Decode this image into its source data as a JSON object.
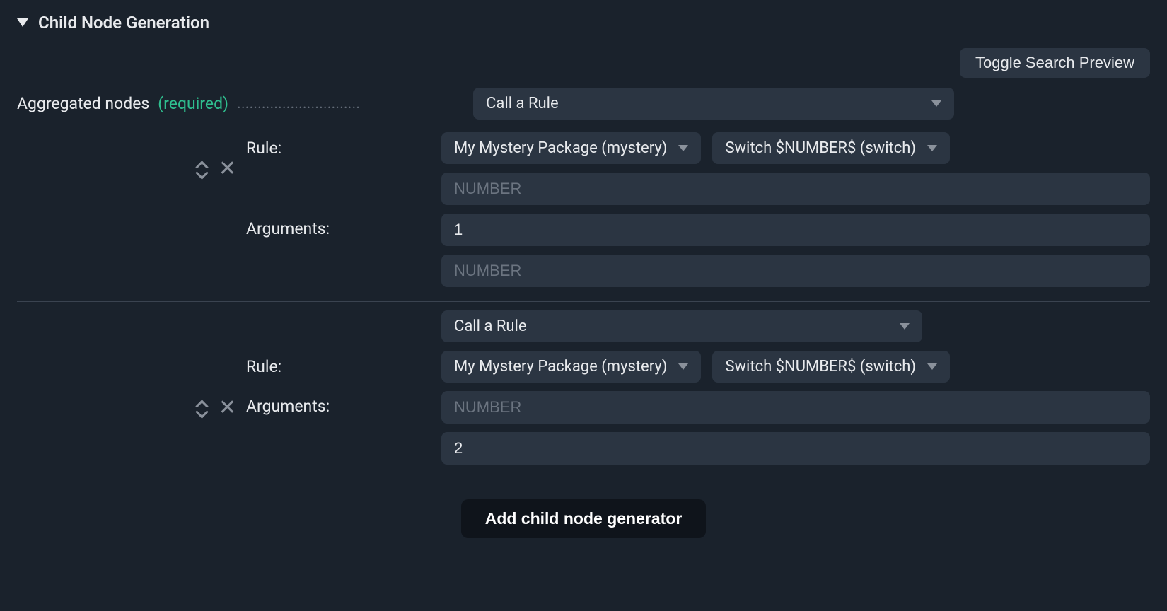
{
  "section": {
    "title": "Child Node Generation"
  },
  "toggle": {
    "label": "Toggle Search Preview"
  },
  "aggregated": {
    "label": "Aggregated nodes",
    "required": "(required)",
    "dots": "..............................",
    "action": "Call a Rule"
  },
  "labels": {
    "rule": "Rule:",
    "arguments": "Arguments:"
  },
  "placeholders": {
    "number": "NUMBER"
  },
  "selects": {
    "package": "My Mystery Package (mystery)",
    "switch": "Switch $NUMBER$ (switch)"
  },
  "nodes": [
    {
      "action": "Call a Rule",
      "arg_value": "1"
    },
    {
      "action": "Call a Rule",
      "arg_value": "2"
    }
  ],
  "footer": {
    "add_button": "Add child node generator"
  }
}
